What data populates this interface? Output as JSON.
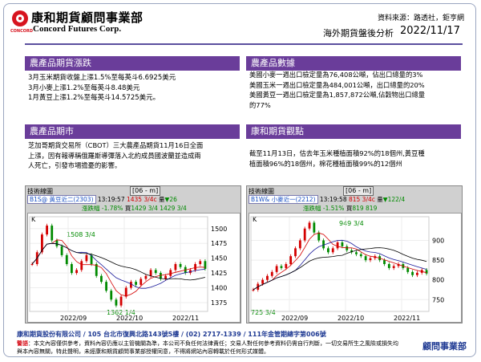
{
  "header": {
    "logo_cn": "康和期貨顧問事業部",
    "logo_en": "Concord Futures Corp.",
    "logo_sub": "CONCORD",
    "source": "資料來源：路透社，鉅亨網",
    "report_title": "海外期貨盤後分析",
    "date": "2022/11/17"
  },
  "sections": {
    "price_moves": {
      "title": "農產品期貨漲跌",
      "lines": [
        "3月玉米期貨收盤上漲1.5%至每英斗6.6925美元",
        "3月小麥上漲1.2%至每英斗8.48美元",
        "1月黃豆上漲1.2%至每英斗14.5725美元。"
      ]
    },
    "data": {
      "title": "農產品數據",
      "lines": [
        "美國小麥一週出口檢定量為76,408公噸，佔出口總量的3%",
        "美國玉米一週出口檢定量為484,001公噸，出口總量的20%",
        "美國黃豆一週出口檢定量為1,857,872公噸,佔穀物出口總量",
        "的77%"
      ]
    },
    "market": {
      "title": "農產品期市",
      "lines": [
        "芝加哥期貨交易所（CBOT）三大農產品期貨11月16日全面",
        "上漲，因有報導稱俄羅斯導彈落入北約成員國波蘭並造成兩",
        "人死亡，引發市場擔憂的影響。"
      ]
    },
    "view": {
      "title": "康和期貨觀點",
      "lines": [
        "截至11月13日，估去年玉米種植面積92%的18個州,黃豆種",
        "植面積96%的18個州，棉花種植面積99%的12個州"
      ]
    }
  },
  "panels": [
    {
      "title": "技術線圖",
      "tab": "[06 - m]",
      "symbol": "B1S@ 黃豆近二(2303)",
      "time": "13:19:57",
      "last": "1435 3/4c",
      "vol_label": "量",
      "vol": "26",
      "change_pct": "漲跌幅 -1.78%",
      "price_label": "買",
      "price": "1429 3/4",
      "last2": "1429 3/4",
      "chart_label": "K",
      "high_label": "1508 3/4",
      "low_label": "1362 1/4",
      "y_ticks": [
        "1500",
        "1475",
        "1450",
        "1425",
        "1400",
        "1375"
      ],
      "x_ticks": [
        "2022/09",
        "2022/10",
        "2022/11"
      ]
    },
    {
      "title": "技術線圖",
      "tab": "[06 - m]",
      "symbol": "B1W& 小麥近一(2212)",
      "time": "13:19:58",
      "last": "815 3/4c",
      "vol_label": "量",
      "vol": "122/4",
      "change_pct": "漲跌幅 -1.51%",
      "price_label": "買",
      "price": "819",
      "last2": "819",
      "chart_label": "K",
      "high_label": "949 3/4",
      "low_label": "725 3/4",
      "y_ticks": [
        "900",
        "850",
        "800",
        "750"
      ],
      "x_ticks": [
        "2022/09",
        "2022/10",
        "2022/11"
      ]
    }
  ],
  "footer": {
    "company": "康和期貨股份有限公司 / 105 台北市復興北路143號5樓 / (02) 2717-1339 / 111年金管期總字第006號",
    "warning_label": "警語",
    "warning": "本文內容僅供參考，資料內容仍應以主管機關為準，本公司不負任何法律責任；交易人對任何參考資料仍需自行判斷，一切交易所生之風險或損失均與本內容無關，特此聲明，未經康和期貨顧問事業部授權同意，不得將網站內容轉載於任何形式媒體。",
    "brand": "顧問事業部"
  },
  "colors": {
    "section_header": "#6a3d9a",
    "brand_red": "#d7141f",
    "footer_blue": "#1f3a93"
  }
}
